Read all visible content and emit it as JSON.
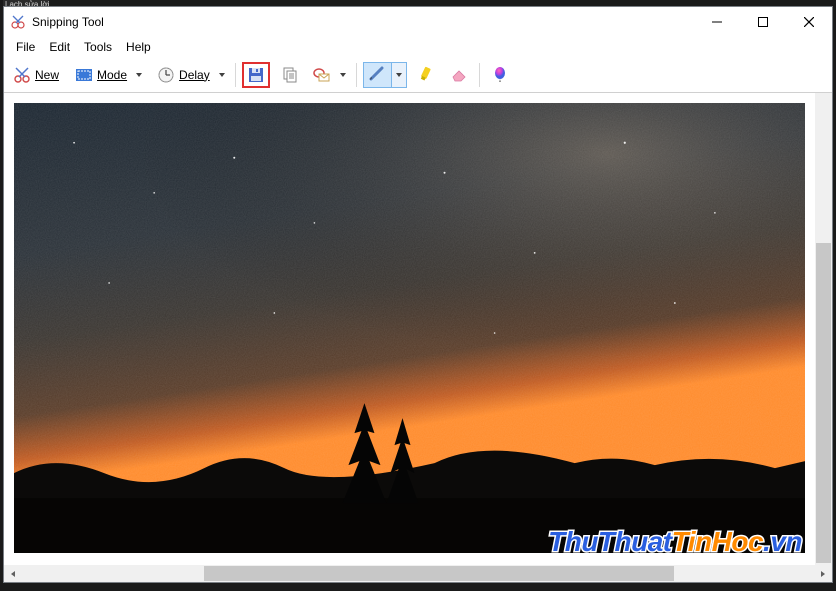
{
  "top_strip": "Lạch sửa lời",
  "titlebar": {
    "app_name": "Snipping Tool"
  },
  "menus": {
    "file": "File",
    "edit": "Edit",
    "tools": "Tools",
    "help": "Help"
  },
  "toolbar": {
    "new_label": "New",
    "mode_label": "Mode",
    "delay_label": "Delay"
  },
  "watermark": {
    "p1": "ThuThuat",
    "p2": "TinHoc",
    "p3": ".vn"
  }
}
